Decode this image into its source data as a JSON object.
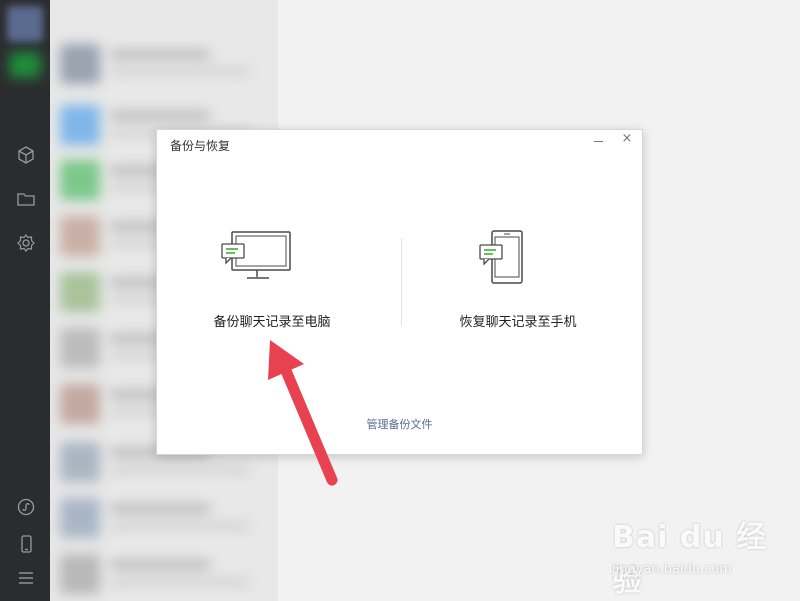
{
  "dialog": {
    "title": "备份与恢复",
    "minimize_icon": "minimize-icon",
    "close_symbol": "×",
    "backup_to_pc_label": "备份聊天记录至电脑",
    "restore_to_phone_label": "恢复聊天记录至手机",
    "manage_backup_link": "管理备份文件"
  },
  "sidebar": {
    "icons": [
      "cube-icon",
      "folder-icon",
      "gear-icon",
      "mini-program-icon",
      "phone-icon",
      "menu-icon"
    ]
  },
  "colors": {
    "sidebar_bg": "#2b2c2f",
    "accent_green": "#3cb034",
    "link_blue": "#576b95",
    "arrow_red": "#e8414f"
  },
  "watermark": {
    "logo": "Bai du 经验",
    "url": "jingyan.baidu.com"
  }
}
